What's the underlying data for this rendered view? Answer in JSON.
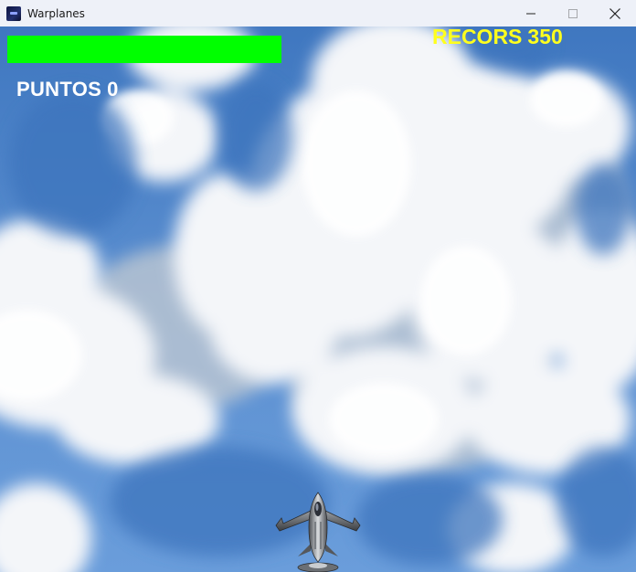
{
  "window": {
    "title": "Warplanes",
    "icon": "warplanes-app-icon"
  },
  "controls": {
    "minimize_icon": "minimize-icon",
    "maximize_icon": "maximize-icon",
    "close_icon": "close-icon"
  },
  "hud": {
    "health_fraction": 1.0,
    "health_color": "#00ff00",
    "score_label": "PUNTOS",
    "score_value": "0",
    "record_label": "RECORS",
    "record_value": "350",
    "record_color": "#ffff1e"
  },
  "player": {
    "icon": "fighter-jet-icon"
  }
}
